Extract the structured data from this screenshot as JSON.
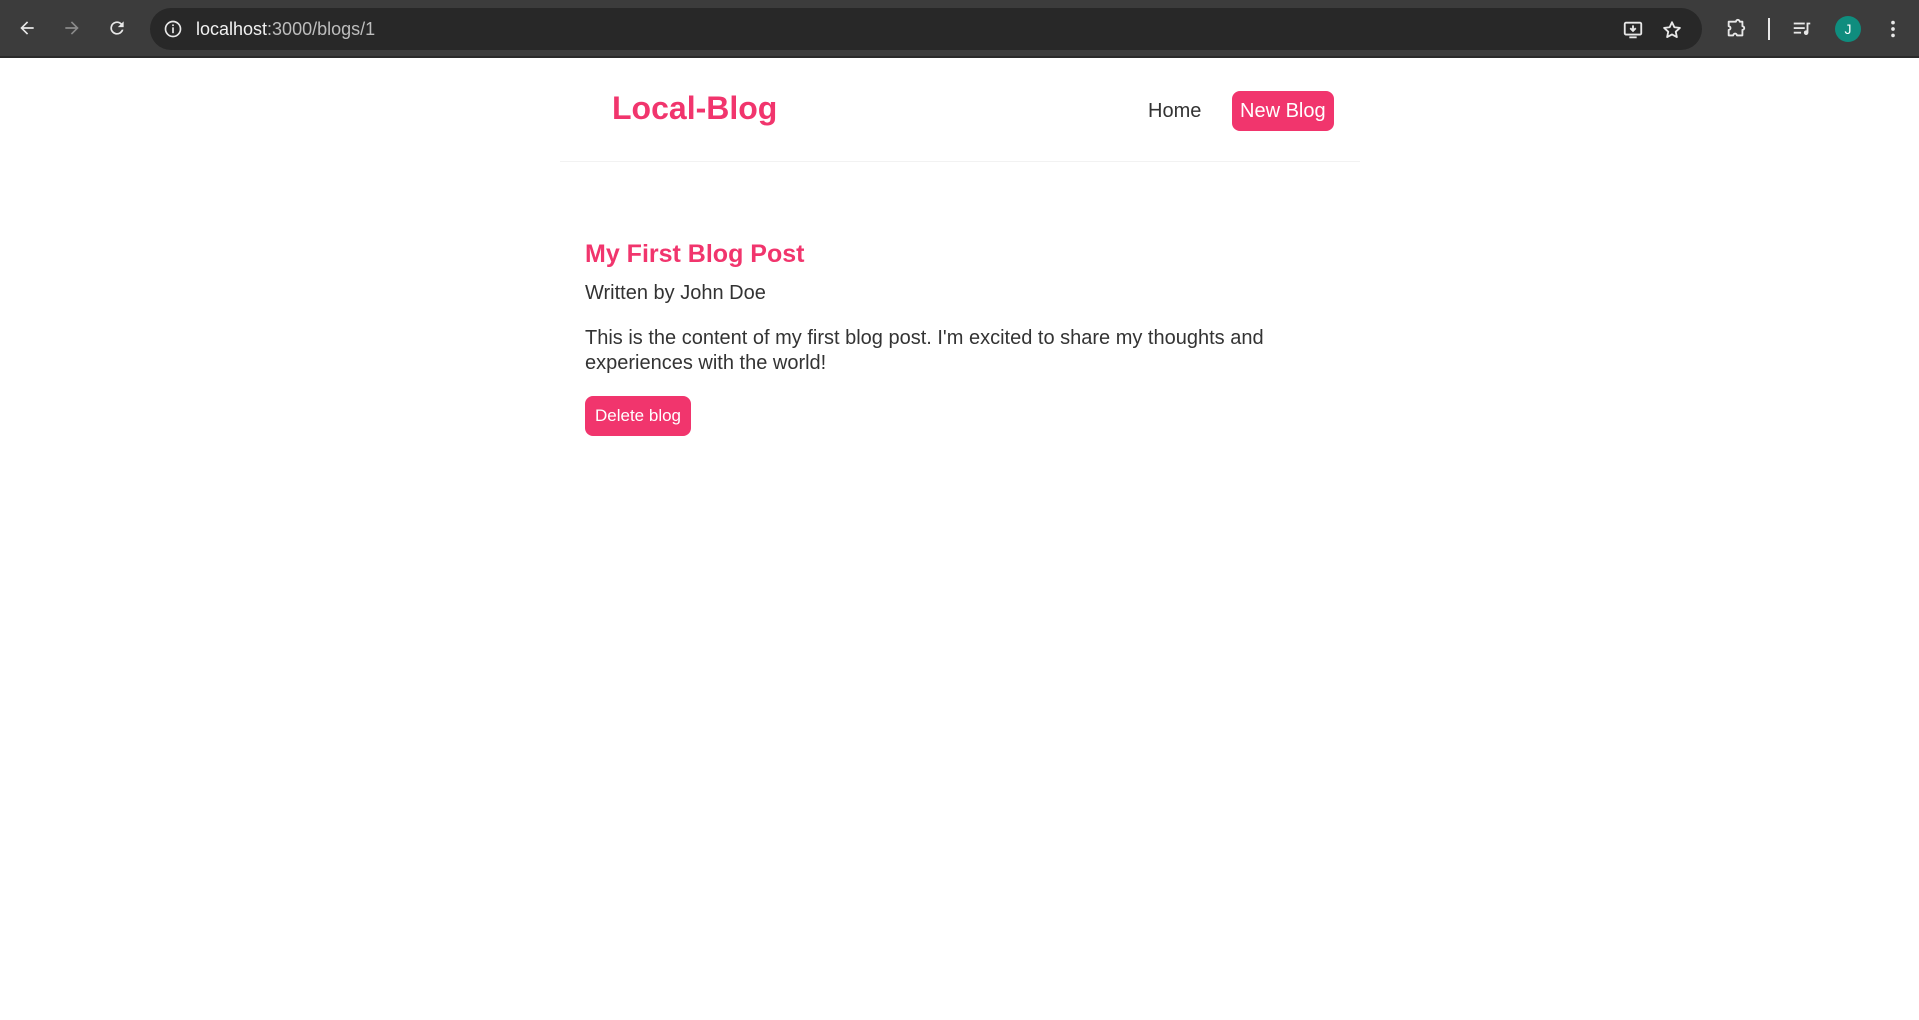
{
  "browser": {
    "url_host": "localhost",
    "url_path": ":3000/blogs/1",
    "avatar_initial": "J",
    "icons": {
      "back": "arrow-left-icon",
      "forward": "arrow-right-icon",
      "reload": "reload-icon",
      "site_info": "info-icon",
      "install": "install-app-icon",
      "bookmark": "star-icon",
      "extensions": "puzzle-icon",
      "media": "media-queue-icon",
      "menu": "kebab-menu-icon"
    },
    "avatar_color": "#0f8d7e"
  },
  "navbar": {
    "brand": "Local-Blog",
    "links": {
      "home": "Home",
      "new_blog": "New Blog"
    }
  },
  "blog": {
    "title": "My First Blog Post",
    "author_line": "Written by John Doe",
    "body": "This is the content of my first blog post. I'm excited to share my thoughts and experiences with the world!",
    "delete_label": "Delete blog"
  },
  "colors": {
    "accent": "#f1356d",
    "text": "#333333",
    "chrome_bg": "#3c3c3c",
    "omnibox_bg": "#282828"
  }
}
